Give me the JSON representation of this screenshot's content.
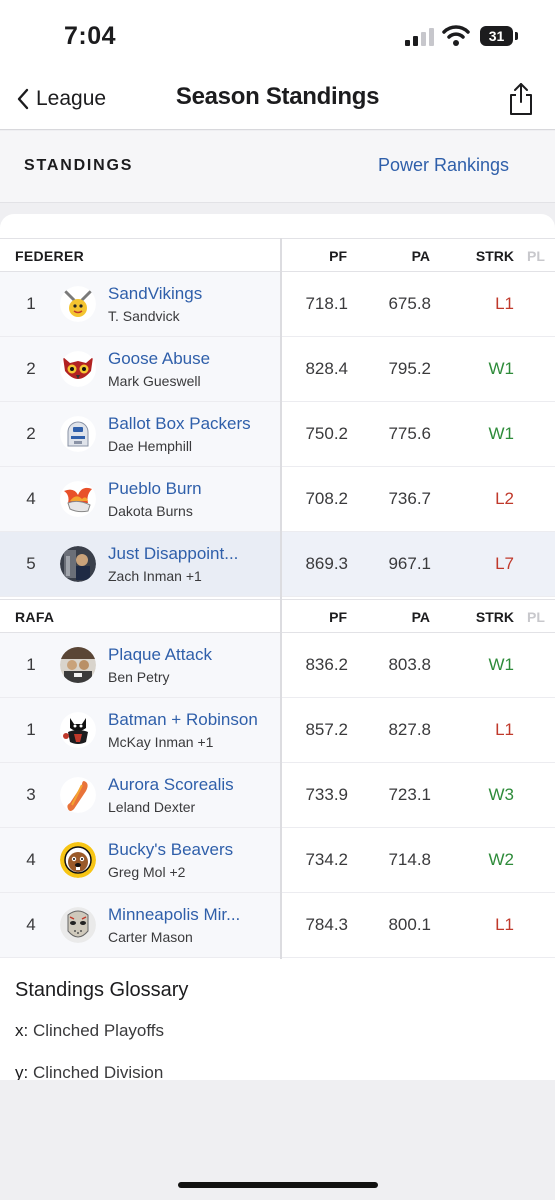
{
  "status_bar": {
    "time": "7:04",
    "battery": "31"
  },
  "nav": {
    "back_label": "League",
    "title": "Season Standings"
  },
  "subbar": {
    "left": "STANDINGS",
    "right": "Power Rankings"
  },
  "columns": {
    "pf": "PF",
    "pa": "PA",
    "strk": "STRK",
    "pl": "PL"
  },
  "divisions": [
    {
      "name": "FEDERER",
      "teams": [
        {
          "rank": "1",
          "name": "SandVikings",
          "owner": "T. Sandvick",
          "pf": "718.1",
          "pa": "675.8",
          "strk": "L1"
        },
        {
          "rank": "2",
          "name": "Goose Abuse",
          "owner": "Mark Gueswell",
          "pf": "828.4",
          "pa": "795.2",
          "strk": "W1"
        },
        {
          "rank": "2",
          "name": "Ballot Box Packers",
          "owner": "Dae Hemphill",
          "pf": "750.2",
          "pa": "775.6",
          "strk": "W1"
        },
        {
          "rank": "4",
          "name": "Pueblo Burn",
          "owner": "Dakota Burns",
          "pf": "708.2",
          "pa": "736.7",
          "strk": "L2"
        },
        {
          "rank": "5",
          "name": "Just Disappoint...",
          "owner": "Zach Inman +1",
          "pf": "869.3",
          "pa": "967.1",
          "strk": "L7"
        }
      ]
    },
    {
      "name": "RAFA",
      "teams": [
        {
          "rank": "1",
          "name": "Plaque Attack",
          "owner": "Ben Petry",
          "pf": "836.2",
          "pa": "803.8",
          "strk": "W1"
        },
        {
          "rank": "1",
          "name": "Batman + Robinson",
          "owner": "McKay Inman +1",
          "pf": "857.2",
          "pa": "827.8",
          "strk": "L1"
        },
        {
          "rank": "3",
          "name": "Aurora Scorealis",
          "owner": "Leland Dexter",
          "pf": "733.9",
          "pa": "723.1",
          "strk": "W3"
        },
        {
          "rank": "4",
          "name": "Bucky's Beavers",
          "owner": "Greg Mol +2",
          "pf": "734.2",
          "pa": "714.8",
          "strk": "W2"
        },
        {
          "rank": "4",
          "name": "Minneapolis Mir...",
          "owner": "Carter Mason",
          "pf": "784.3",
          "pa": "800.1",
          "strk": "L1"
        }
      ]
    }
  ],
  "glossary": {
    "title": "Standings Glossary",
    "items": [
      {
        "key": "x:",
        "text": " Clinched Playoffs"
      },
      {
        "key": "y:",
        "text": " Clinched Division"
      }
    ]
  },
  "colors": {
    "link": "#2f5faa",
    "win": "#2e8b3a",
    "loss": "#c0392b"
  }
}
